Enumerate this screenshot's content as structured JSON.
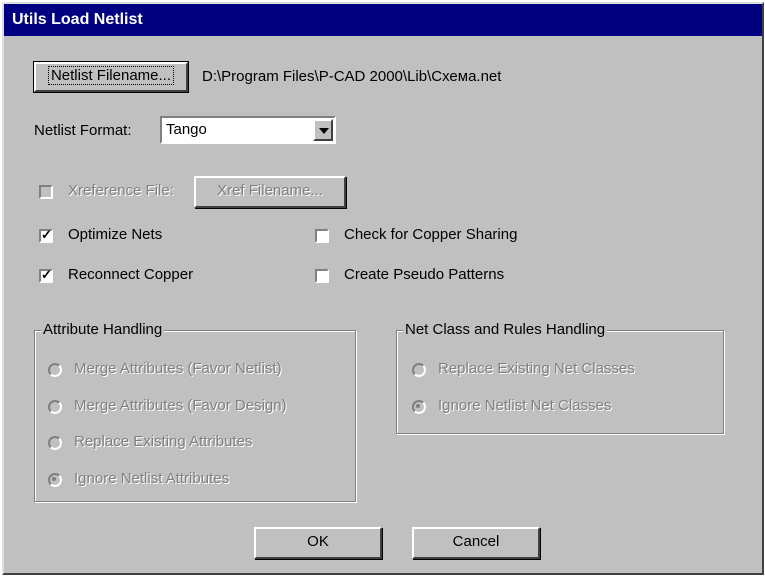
{
  "window": {
    "title": "Utils Load Netlist"
  },
  "netlist": {
    "button_label": "Netlist Filename...",
    "path": "D:\\Program Files\\P-CAD 2000\\Lib\\Схема.net",
    "format_label": "Netlist Format:",
    "format_value": "Tango"
  },
  "xref": {
    "checkbox_label": "Xreference File:",
    "checked": false,
    "enabled": false,
    "button_label": "Xref Filename..."
  },
  "options": [
    {
      "label": "Optimize Nets",
      "checked": true
    },
    {
      "label": "Reconnect Copper",
      "checked": true
    },
    {
      "label": "Check for Copper Sharing",
      "checked": false
    },
    {
      "label": "Create Pseudo Patterns",
      "checked": false
    }
  ],
  "attribute_handling": {
    "title": "Attribute Handling",
    "enabled": false,
    "options": [
      {
        "label": "Merge Attributes (Favor Netlist)",
        "selected": false
      },
      {
        "label": "Merge Attributes (Favor Design)",
        "selected": false
      },
      {
        "label": "Replace Existing Attributes",
        "selected": false
      },
      {
        "label": "Ignore Netlist Attributes",
        "selected": true
      }
    ]
  },
  "net_class_handling": {
    "title": "Net Class and Rules Handling",
    "enabled": false,
    "options": [
      {
        "label": "Replace Existing Net Classes",
        "selected": false
      },
      {
        "label": "Ignore Netlist Net Classes",
        "selected": true
      }
    ]
  },
  "buttons": {
    "ok": "OK",
    "cancel": "Cancel"
  }
}
